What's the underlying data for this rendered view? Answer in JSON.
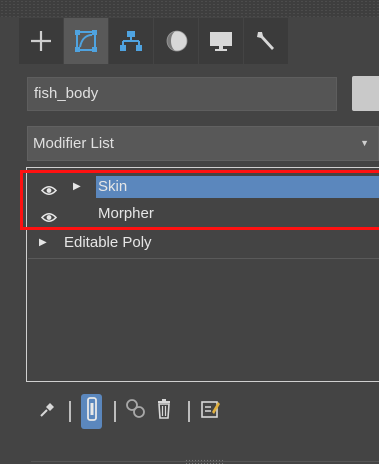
{
  "object_name": {
    "value": "fish_body"
  },
  "modifier_list": {
    "label": "Modifier List",
    "arrow": "▼"
  },
  "command_tabs": [
    {
      "name": "create",
      "icon": "plus-icon"
    },
    {
      "name": "modify",
      "icon": "modify-curve-icon",
      "active": true
    },
    {
      "name": "hierarchy",
      "icon": "hierarchy-icon"
    },
    {
      "name": "motion",
      "icon": "motion-sphere-icon"
    },
    {
      "name": "display",
      "icon": "monitor-icon"
    },
    {
      "name": "utilities",
      "icon": "wrench-icon"
    }
  ],
  "modifier_stack": {
    "items": [
      {
        "label": "Skin",
        "selected": true,
        "visible_icon": "eye-icon",
        "expandable": true
      },
      {
        "label": "Morpher",
        "selected": false,
        "visible_icon": "eye-icon",
        "expandable": false
      },
      {
        "label": "Editable Poly",
        "selected": false,
        "expandable": true
      }
    ]
  },
  "stack_toolbar": {
    "icons": [
      "pin-stack-icon",
      "show-end-result-icon",
      "make-unique-icon",
      "remove-modifier-icon",
      "configure-modifier-sets-icon"
    ]
  },
  "colors": {
    "panel_bg": "#444444",
    "selection_blue": "#5b87bd",
    "highlight_red": "#ff1111",
    "active_tab": "#595959",
    "swatch": "#c9c9c9"
  }
}
